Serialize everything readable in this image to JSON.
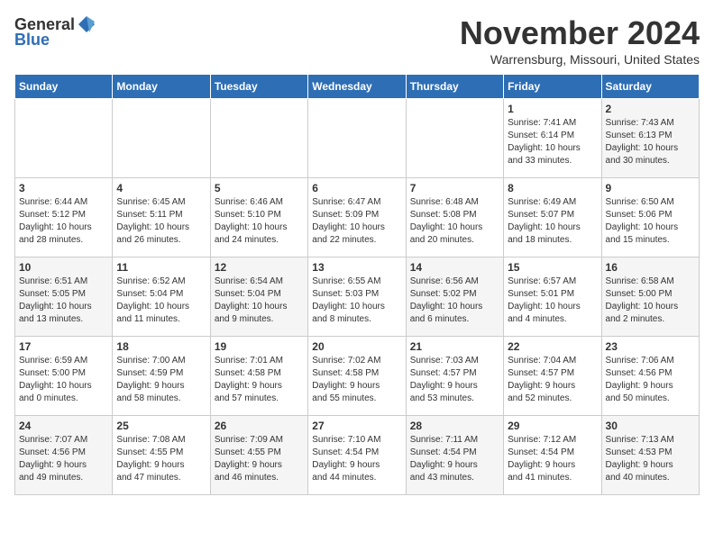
{
  "logo": {
    "general": "General",
    "blue": "Blue"
  },
  "title": "November 2024",
  "location": "Warrensburg, Missouri, United States",
  "headers": [
    "Sunday",
    "Monday",
    "Tuesday",
    "Wednesday",
    "Thursday",
    "Friday",
    "Saturday"
  ],
  "weeks": [
    [
      {
        "day": "",
        "info": ""
      },
      {
        "day": "",
        "info": ""
      },
      {
        "day": "",
        "info": ""
      },
      {
        "day": "",
        "info": ""
      },
      {
        "day": "",
        "info": ""
      },
      {
        "day": "1",
        "info": "Sunrise: 7:41 AM\nSunset: 6:14 PM\nDaylight: 10 hours\nand 33 minutes."
      },
      {
        "day": "2",
        "info": "Sunrise: 7:43 AM\nSunset: 6:13 PM\nDaylight: 10 hours\nand 30 minutes."
      }
    ],
    [
      {
        "day": "3",
        "info": "Sunrise: 6:44 AM\nSunset: 5:12 PM\nDaylight: 10 hours\nand 28 minutes."
      },
      {
        "day": "4",
        "info": "Sunrise: 6:45 AM\nSunset: 5:11 PM\nDaylight: 10 hours\nand 26 minutes."
      },
      {
        "day": "5",
        "info": "Sunrise: 6:46 AM\nSunset: 5:10 PM\nDaylight: 10 hours\nand 24 minutes."
      },
      {
        "day": "6",
        "info": "Sunrise: 6:47 AM\nSunset: 5:09 PM\nDaylight: 10 hours\nand 22 minutes."
      },
      {
        "day": "7",
        "info": "Sunrise: 6:48 AM\nSunset: 5:08 PM\nDaylight: 10 hours\nand 20 minutes."
      },
      {
        "day": "8",
        "info": "Sunrise: 6:49 AM\nSunset: 5:07 PM\nDaylight: 10 hours\nand 18 minutes."
      },
      {
        "day": "9",
        "info": "Sunrise: 6:50 AM\nSunset: 5:06 PM\nDaylight: 10 hours\nand 15 minutes."
      }
    ],
    [
      {
        "day": "10",
        "info": "Sunrise: 6:51 AM\nSunset: 5:05 PM\nDaylight: 10 hours\nand 13 minutes."
      },
      {
        "day": "11",
        "info": "Sunrise: 6:52 AM\nSunset: 5:04 PM\nDaylight: 10 hours\nand 11 minutes."
      },
      {
        "day": "12",
        "info": "Sunrise: 6:54 AM\nSunset: 5:04 PM\nDaylight: 10 hours\nand 9 minutes."
      },
      {
        "day": "13",
        "info": "Sunrise: 6:55 AM\nSunset: 5:03 PM\nDaylight: 10 hours\nand 8 minutes."
      },
      {
        "day": "14",
        "info": "Sunrise: 6:56 AM\nSunset: 5:02 PM\nDaylight: 10 hours\nand 6 minutes."
      },
      {
        "day": "15",
        "info": "Sunrise: 6:57 AM\nSunset: 5:01 PM\nDaylight: 10 hours\nand 4 minutes."
      },
      {
        "day": "16",
        "info": "Sunrise: 6:58 AM\nSunset: 5:00 PM\nDaylight: 10 hours\nand 2 minutes."
      }
    ],
    [
      {
        "day": "17",
        "info": "Sunrise: 6:59 AM\nSunset: 5:00 PM\nDaylight: 10 hours\nand 0 minutes."
      },
      {
        "day": "18",
        "info": "Sunrise: 7:00 AM\nSunset: 4:59 PM\nDaylight: 9 hours\nand 58 minutes."
      },
      {
        "day": "19",
        "info": "Sunrise: 7:01 AM\nSunset: 4:58 PM\nDaylight: 9 hours\nand 57 minutes."
      },
      {
        "day": "20",
        "info": "Sunrise: 7:02 AM\nSunset: 4:58 PM\nDaylight: 9 hours\nand 55 minutes."
      },
      {
        "day": "21",
        "info": "Sunrise: 7:03 AM\nSunset: 4:57 PM\nDaylight: 9 hours\nand 53 minutes."
      },
      {
        "day": "22",
        "info": "Sunrise: 7:04 AM\nSunset: 4:57 PM\nDaylight: 9 hours\nand 52 minutes."
      },
      {
        "day": "23",
        "info": "Sunrise: 7:06 AM\nSunset: 4:56 PM\nDaylight: 9 hours\nand 50 minutes."
      }
    ],
    [
      {
        "day": "24",
        "info": "Sunrise: 7:07 AM\nSunset: 4:56 PM\nDaylight: 9 hours\nand 49 minutes."
      },
      {
        "day": "25",
        "info": "Sunrise: 7:08 AM\nSunset: 4:55 PM\nDaylight: 9 hours\nand 47 minutes."
      },
      {
        "day": "26",
        "info": "Sunrise: 7:09 AM\nSunset: 4:55 PM\nDaylight: 9 hours\nand 46 minutes."
      },
      {
        "day": "27",
        "info": "Sunrise: 7:10 AM\nSunset: 4:54 PM\nDaylight: 9 hours\nand 44 minutes."
      },
      {
        "day": "28",
        "info": "Sunrise: 7:11 AM\nSunset: 4:54 PM\nDaylight: 9 hours\nand 43 minutes."
      },
      {
        "day": "29",
        "info": "Sunrise: 7:12 AM\nSunset: 4:54 PM\nDaylight: 9 hours\nand 41 minutes."
      },
      {
        "day": "30",
        "info": "Sunrise: 7:13 AM\nSunset: 4:53 PM\nDaylight: 9 hours\nand 40 minutes."
      }
    ]
  ]
}
